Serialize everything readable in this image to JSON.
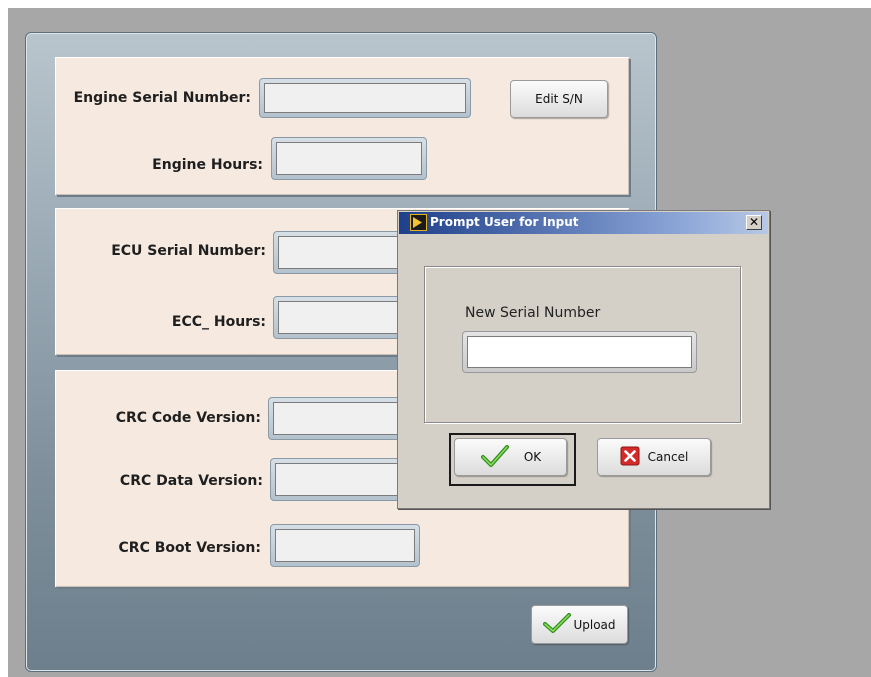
{
  "form": {
    "engine_serial_label": "Engine Serial Number:",
    "engine_serial_value": "",
    "edit_sn_label": "Edit S/N",
    "engine_hours_label": "Engine Hours:",
    "engine_hours_value": "",
    "ecu_serial_label": "ECU Serial Number:",
    "ecu_serial_value": "",
    "ecc_hours_label": "ECC_ Hours:",
    "ecc_hours_value": "",
    "crc_code_label": "CRC Code Version:",
    "crc_code_value": "",
    "crc_data_label": "CRC Data Version:",
    "crc_data_value": "",
    "crc_boot_label": "CRC Boot Version:",
    "crc_boot_value": "",
    "upload_label": "Upload"
  },
  "dialog": {
    "title": "Prompt User for Input",
    "prompt_label": "New Serial Number",
    "input_value": "",
    "ok_label": "OK",
    "cancel_label": "Cancel",
    "close_glyph": "✕"
  },
  "colors": {
    "panel_bg": "#f5e9e0",
    "titlebar_start": "#1e3f8a",
    "checkmark": "#4caf2a",
    "cancel_red": "#d42a2a"
  },
  "icons": {
    "ok": "checkmark-icon",
    "cancel": "x-mark-icon",
    "upload": "checkmark-icon",
    "window": "app-icon"
  }
}
